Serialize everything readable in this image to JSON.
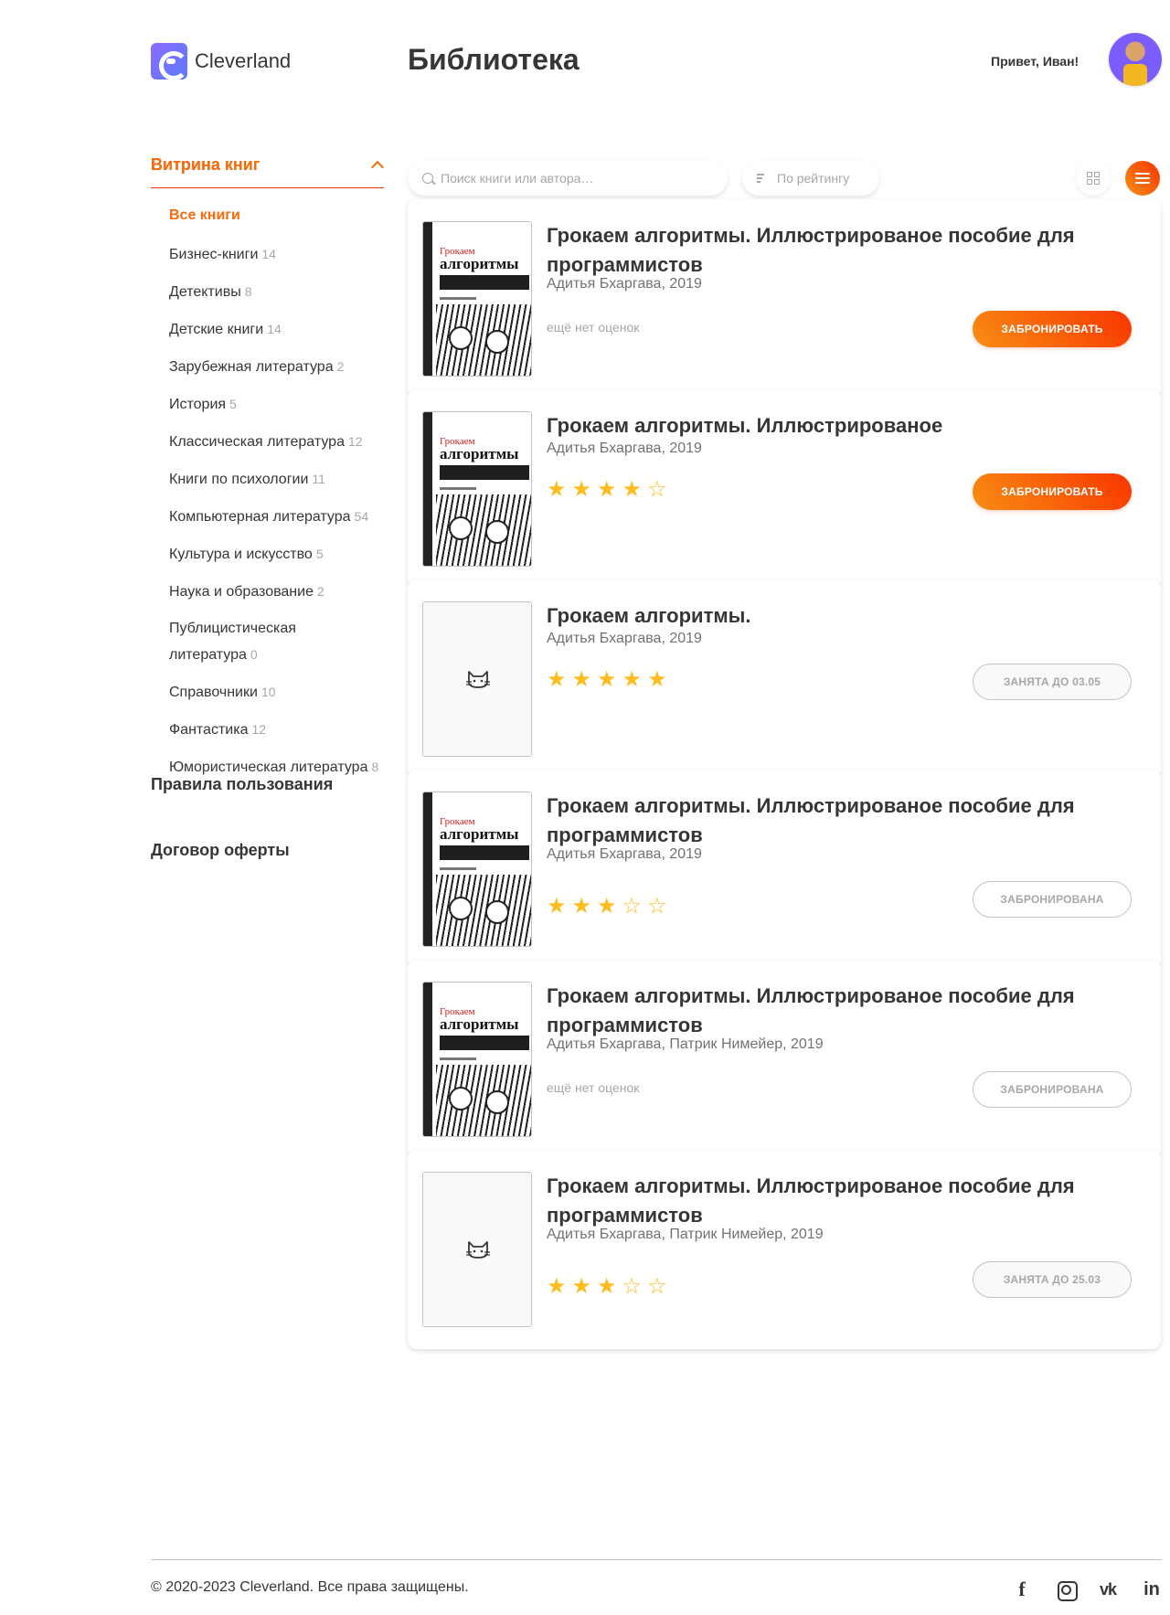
{
  "header": {
    "logo_text": "Cleverland",
    "page_title": "Библиотека",
    "greeting": "Привет, Иван!"
  },
  "sidebar": {
    "section_title": "Витрина книг",
    "categories": [
      {
        "label": "Все книги",
        "count": "",
        "active": true
      },
      {
        "label": "Бизнес-книги",
        "count": "14"
      },
      {
        "label": "Детективы",
        "count": "8"
      },
      {
        "label": "Детские книги",
        "count": "14"
      },
      {
        "label": "Зарубежная литература",
        "count": "2"
      },
      {
        "label": "История",
        "count": "5"
      },
      {
        "label": "Классическая литература",
        "count": "12"
      },
      {
        "label": "Книги по психологии",
        "count": "11"
      },
      {
        "label": "Компьютерная литература",
        "count": "54"
      },
      {
        "label": "Культура и искусство",
        "count": "5"
      },
      {
        "label": "Наука и образование",
        "count": "2"
      },
      {
        "label": "Публицистическая литература",
        "count": "0"
      },
      {
        "label": "Справочники",
        "count": "10"
      },
      {
        "label": "Фантастика",
        "count": "12"
      },
      {
        "label": "Юмористическая литература",
        "count": "8"
      }
    ],
    "terms_link": "Правила пользования",
    "offer_link": "Договор оферты"
  },
  "toolbar": {
    "search_placeholder": "Поиск книги или автора…",
    "sort_label": "По рейтингу"
  },
  "colors": {
    "accent": "#f56b0e",
    "star": "#ffbc1f",
    "text": "#363636",
    "muted": "#a7a7a7"
  },
  "books": [
    {
      "title": "Грокаем алгоритмы. Иллюстрированое пособие для программистов",
      "author": "Адитья Бхаргава, 2019",
      "cover": "image",
      "rating": null,
      "no_rating_text": "ещё нет оценок",
      "button": "ЗАБРОНИРОВАТЬ",
      "button_state": "primary"
    },
    {
      "title": "Грокаем алгоритмы. Иллюстрированое",
      "author": "Адитья Бхаргава, 2019",
      "cover": "image",
      "rating": 4,
      "button": "ЗАБРОНИРОВАТЬ",
      "button_state": "primary"
    },
    {
      "title": "Грокаем алгоритмы.",
      "author": "Адитья Бхаргава, 2019",
      "cover": "placeholder",
      "rating": 5,
      "button": "ЗАНЯТА ДО 03.05",
      "button_state": "busy"
    },
    {
      "title": "Грокаем алгоритмы. Иллюстрированое пособие для программистов",
      "author": "Адитья Бхаргава, 2019",
      "cover": "image",
      "rating": 3,
      "button": "ЗАБРОНИРОВАНА",
      "button_state": "booked"
    },
    {
      "title": "Грокаем алгоритмы. Иллюстрированое пособие для программистов",
      "author": "Адитья Бхаргава, Патрик Нимейер, 2019",
      "cover": "image",
      "rating": null,
      "no_rating_text": "ещё нет оценок",
      "button": "ЗАБРОНИРОВАНА",
      "button_state": "booked"
    },
    {
      "title": "Грокаем алгоритмы. Иллюстрированое пособие для программистов",
      "author": "Адитья Бхаргава, Патрик Нимейер, 2019",
      "cover": "placeholder",
      "rating": 3,
      "button": "ЗАНЯТА ДО 25.03",
      "button_state": "busy"
    }
  ],
  "cover_art": {
    "small_title": "Грокаем",
    "big_title": "алгоритмы"
  },
  "footer": {
    "copyright": "© 2020-2023 Cleverland. Все права защищены.",
    "social": [
      "facebook-icon",
      "instagram-icon",
      "vk-icon",
      "linkedin-icon"
    ]
  }
}
